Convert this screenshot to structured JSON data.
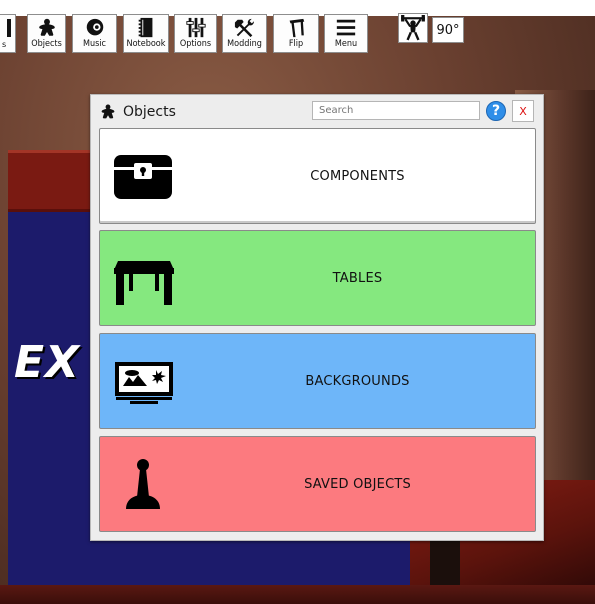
{
  "toolbar": {
    "partial_label": "s",
    "buttons": [
      {
        "label": "Objects",
        "icon": "meeple-icon"
      },
      {
        "label": "Music",
        "icon": "speaker-icon"
      },
      {
        "label": "Notebook",
        "icon": "notebook-icon"
      },
      {
        "label": "Options",
        "icon": "sliders-icon"
      },
      {
        "label": "Modding",
        "icon": "tools-icon"
      },
      {
        "label": "Flip",
        "icon": "flip-table-icon"
      },
      {
        "label": "Menu",
        "icon": "hamburger-icon"
      }
    ],
    "rotate_icon": "weightlifter-icon",
    "rotation_value": "90°"
  },
  "background": {
    "partial_text": "EX"
  },
  "objects_window": {
    "title": "Objects",
    "search_placeholder": "Search",
    "help_label": "?",
    "close_label": "X",
    "categories": [
      {
        "label": "COMPONENTS",
        "icon": "chest-icon",
        "color": "#ffffff"
      },
      {
        "label": "TABLES",
        "icon": "table-icon",
        "color": "#85e87f"
      },
      {
        "label": "BACKGROUNDS",
        "icon": "monitor-landscape-icon",
        "color": "#6eb6f9"
      },
      {
        "label": "SAVED OBJECTS",
        "icon": "joystick-pawn-icon",
        "color": "#fc7a7f"
      }
    ]
  }
}
